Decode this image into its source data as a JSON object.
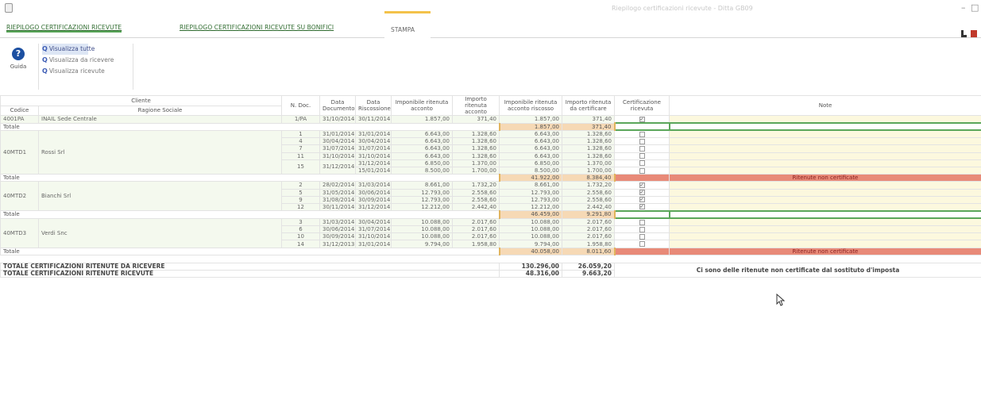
{
  "window": {
    "title": "Riepilogo certificazioni ricevute - Ditta GB09",
    "controls": [
      "–",
      "□"
    ]
  },
  "tabs": [
    {
      "label": "RIEPILOGO CERTIFICAZIONI RICEVUTE"
    },
    {
      "label": "RIEPILOGO CERTIFICAZIONI RICEVUTE SU BONIFICI"
    },
    {
      "label": "STAMPA"
    }
  ],
  "ribbon": {
    "help_label": "Guida",
    "view_items": [
      "Visualizza tutte",
      "Visualizza da ricevere",
      "Visualizza ricevute"
    ]
  },
  "headers": {
    "cliente": "Cliente",
    "codice": "Codice",
    "ragione_sociale": "Ragione Sociale",
    "n_doc": "N. Doc.",
    "data_documento": "Data Documento",
    "data_riscossione": "Data Riscossione",
    "imponibile": "Imponibile ritenuta acconto",
    "importo_ritenuta": "Importo ritenuta acconto",
    "imponibile_riscosso": "Imponibile ritenuta acconto riscosso",
    "importo_certificare": "Importo ritenuta da certificare",
    "certificazione": "Certificazione ricevuta",
    "note": "Note"
  },
  "groups": [
    {
      "codice": "4001PA",
      "ragione": "INAIL Sede Centrale",
      "rows": [
        {
          "ndoc": "1/PA",
          "doc": "31/10/2014",
          "risc": "30/11/2014",
          "imp": "1.857,00",
          "rit": "371,40",
          "impr": "1.857,00",
          "cert_amt": "371,40",
          "checked": true
        }
      ],
      "total": {
        "label": "Totale",
        "impr": "1.857,00",
        "cert_amt": "371,40",
        "note": ""
      }
    },
    {
      "codice": "40MTD1",
      "ragione": "Rossi Srl",
      "rows": [
        {
          "ndoc": "1",
          "doc": "31/01/2014",
          "risc": "31/01/2014",
          "imp": "6.643,00",
          "rit": "1.328,60",
          "impr": "6.643,00",
          "cert_amt": "1.328,60",
          "checked": false
        },
        {
          "ndoc": "4",
          "doc": "30/04/2014",
          "risc": "30/04/2014",
          "imp": "6.643,00",
          "rit": "1.328,60",
          "impr": "6.643,00",
          "cert_amt": "1.328,60",
          "checked": false
        },
        {
          "ndoc": "7",
          "doc": "31/07/2014",
          "risc": "31/07/2014",
          "imp": "6.643,00",
          "rit": "1.328,60",
          "impr": "6.643,00",
          "cert_amt": "1.328,60",
          "checked": false
        },
        {
          "ndoc": "11",
          "doc": "31/10/2014",
          "risc": "31/10/2014",
          "imp": "6.643,00",
          "rit": "1.328,60",
          "impr": "6.643,00",
          "cert_amt": "1.328,60",
          "checked": false
        },
        {
          "ndoc": "15",
          "doc": "31/12/2014",
          "risc": "31/12/2014",
          "imp": "6.850,00",
          "rit": "1.370,00",
          "impr": "6.850,00",
          "cert_amt": "1.370,00",
          "checked": false
        },
        {
          "ndoc": "",
          "doc": "",
          "risc": "15/01/2014",
          "imp": "8.500,00",
          "rit": "1.700,00",
          "impr": "8.500,00",
          "cert_amt": "1.700,00",
          "checked": false
        }
      ],
      "total": {
        "label": "Totale",
        "impr": "41.922,00",
        "cert_amt": "8.384,40",
        "note": "Ritenute non certificate"
      }
    },
    {
      "codice": "40MTD2",
      "ragione": "Bianchi Srl",
      "rows": [
        {
          "ndoc": "2",
          "doc": "28/02/2014",
          "risc": "31/03/2014",
          "imp": "8.661,00",
          "rit": "1.732,20",
          "impr": "8.661,00",
          "cert_amt": "1.732,20",
          "checked": true
        },
        {
          "ndoc": "5",
          "doc": "31/05/2014",
          "risc": "30/06/2014",
          "imp": "12.793,00",
          "rit": "2.558,60",
          "impr": "12.793,00",
          "cert_amt": "2.558,60",
          "checked": true
        },
        {
          "ndoc": "9",
          "doc": "31/08/2014",
          "risc": "30/09/2014",
          "imp": "12.793,00",
          "rit": "2.558,60",
          "impr": "12.793,00",
          "cert_amt": "2.558,60",
          "checked": true
        },
        {
          "ndoc": "12",
          "doc": "30/11/2014",
          "risc": "31/12/2014",
          "imp": "12.212,00",
          "rit": "2.442,40",
          "impr": "12.212,00",
          "cert_amt": "2.442,40",
          "checked": true
        }
      ],
      "total": {
        "label": "Totale",
        "impr": "46.459,00",
        "cert_amt": "9.291,80",
        "note": ""
      }
    },
    {
      "codice": "40MTD3",
      "ragione": "Verdi Snc",
      "rows": [
        {
          "ndoc": "3",
          "doc": "31/03/2014",
          "risc": "30/04/2014",
          "imp": "10.088,00",
          "rit": "2.017,60",
          "impr": "10.088,00",
          "cert_amt": "2.017,60",
          "checked": false
        },
        {
          "ndoc": "6",
          "doc": "30/06/2014",
          "risc": "31/07/2014",
          "imp": "10.088,00",
          "rit": "2.017,60",
          "impr": "10.088,00",
          "cert_amt": "2.017,60",
          "checked": false
        },
        {
          "ndoc": "10",
          "doc": "30/09/2014",
          "risc": "31/10/2014",
          "imp": "10.088,00",
          "rit": "2.017,60",
          "impr": "10.088,00",
          "cert_amt": "2.017,60",
          "checked": false
        },
        {
          "ndoc": "14",
          "doc": "31/12/2013",
          "risc": "31/01/2014",
          "imp": "9.794,00",
          "rit": "1.958,80",
          "impr": "9.794,00",
          "cert_amt": "1.958,80",
          "checked": false
        }
      ],
      "total": {
        "label": "Totale",
        "impr": "40.058,00",
        "cert_amt": "8.011,60",
        "note": "Ritenute non certificate"
      }
    }
  ],
  "grand": {
    "da_ricevere_label": "TOTALE CERTIFICAZIONI RITENUTE DA RICEVERE",
    "da_ricevere_impr": "130.296,00",
    "da_ricevere_amt": "26.059,20",
    "ricevute_label": "TOTALE CERTIFICAZIONI RITENUTE RICEVUTE",
    "ricevute_impr": "48.316,00",
    "ricevute_amt": "9.663,20",
    "warning": "Ci sono delle ritenute non certificate dal sostituto d'imposta"
  },
  "colors": {
    "accent_green": "#5aa65a",
    "header_blue": "#cfe5f6",
    "total_orange": "#f6d9b5",
    "warning_red": "#e88a78",
    "note_yellow": "#fcf8de"
  }
}
